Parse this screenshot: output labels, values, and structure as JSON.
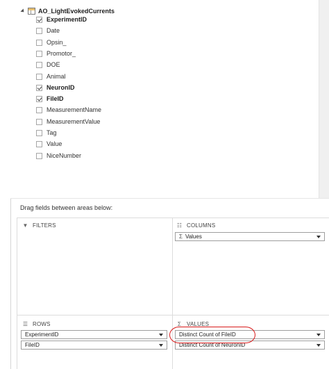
{
  "field_list": {
    "table_name": "AO_LightEvokedCurrents",
    "fields": [
      {
        "label": "ExperimentID",
        "checked": true
      },
      {
        "label": "Date",
        "checked": false
      },
      {
        "label": "Opsin_",
        "checked": false
      },
      {
        "label": "Promotor_",
        "checked": false
      },
      {
        "label": "DOE",
        "checked": false
      },
      {
        "label": "Animal",
        "checked": false
      },
      {
        "label": "NeuronID",
        "checked": true
      },
      {
        "label": "FileID",
        "checked": true
      },
      {
        "label": "MeasurementName",
        "checked": false
      },
      {
        "label": "MeasurementValue",
        "checked": false
      },
      {
        "label": "Tag",
        "checked": false
      },
      {
        "label": "Value",
        "checked": false
      },
      {
        "label": "NiceNumber",
        "checked": false
      }
    ]
  },
  "areas": {
    "hint": "Drag fields between areas below:",
    "filters": {
      "label": "FILTERS",
      "icon": "filter-icon"
    },
    "columns": {
      "label": "COLUMNS",
      "icon": "columns-icon",
      "items": [
        "Values"
      ]
    },
    "rows": {
      "label": "ROWS",
      "icon": "rows-icon",
      "items": [
        "ExperimentID",
        "FileID"
      ]
    },
    "values": {
      "label": "VALUES",
      "icon": "sigma-icon",
      "items": [
        "Distinct Count of FileID",
        "Distinct Count of NeuronID"
      ]
    }
  },
  "colors": {
    "highlight_circle": "#d81a1a"
  }
}
